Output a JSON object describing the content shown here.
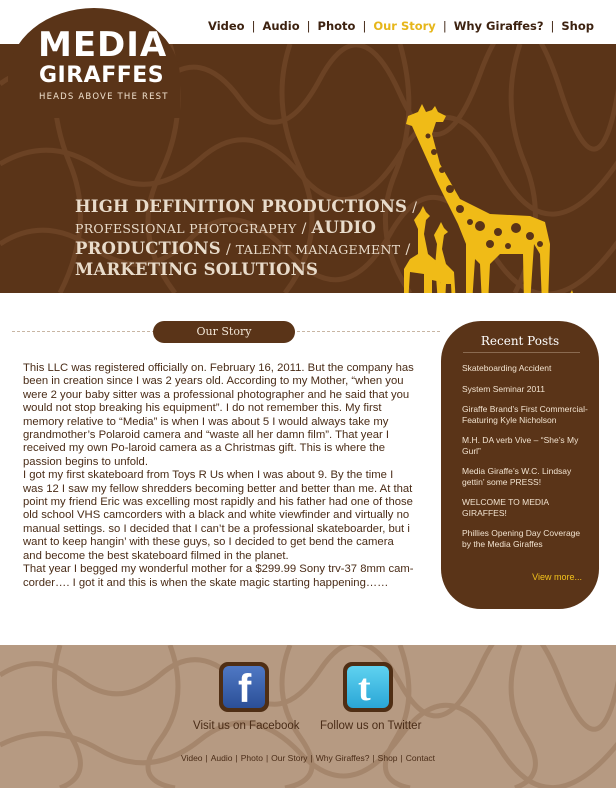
{
  "logo": {
    "line1": "MEDIA",
    "line2": "GIRAFFES",
    "tagline": "HEADS ABOVE THE REST"
  },
  "nav": {
    "items": [
      {
        "label": "Video",
        "active": false
      },
      {
        "label": "Audio",
        "active": false
      },
      {
        "label": "Photo",
        "active": false
      },
      {
        "label": "Our Story",
        "active": true
      },
      {
        "label": "Why Giraffes?",
        "active": false
      },
      {
        "label": "Shop",
        "active": false
      }
    ],
    "separator": "|"
  },
  "hero": {
    "service_1": "HIGH DEFINITION PRODUCTIONS",
    "service_2": "PROFESSIONAL PHOTOGRAPHY",
    "service_3": "AUDIO PRODUCTIONS",
    "service_4": "TALENT MANAGEMENT",
    "service_5": "MARKETING SOLUTIONS",
    "slash": "/"
  },
  "section": {
    "title": "Our Story"
  },
  "story": {
    "paragraph_1": "This LLC was registered officially on. February 16, 2011. But the company has been in creation since I was 2 years old. According to my Mother, “when you were 2 your baby sitter was a professional photographer and he said that you would not stop breaking his equipment”. I do not remember this. My first memory relative to “Media” is when I was about 5 I would always take my grandmother’s Polaroid camera and “waste all her damn film”. That year I received my own Po-laroid camera as a Christmas gift. This is where the passion begins to unfold.",
    "paragraph_2": "I got my first skateboard from Toys R Us when I was about 9. By the time I was 12 I saw my fellow shredders becoming better and better than me. At that point my friend Eric was excelling most rapidly and his father had one of those old school VHS camcorders with a black and white viewfinder and virtually no manual settings. so I decided that I can’t be a professional skateboarder, but i want to keep hangin’ with these guys, so I decided to get bend the camera and become the best skateboard filmed in the planet.",
    "paragraph_3": "That year I begged my wonderful mother for a $299.99 Sony trv-37 8mm cam-corder…. I got it and this is when the skate magic starting happening……"
  },
  "recent_posts": {
    "title": "Recent Posts",
    "items": [
      "Skateboarding Accident",
      "System Seminar 2011",
      "Giraffe Brand’s First Commercial-Featuring Kyle Nicholson",
      "M.H. DA verb Vive – “She’s My Gurl”",
      "Media Giraffe’s W.C. Lindsay gettin’ some PRESS!",
      "WELCOME TO MEDIA GIRAFFES!",
      "Phillies Opening Day Coverage by the Media Giraffes"
    ],
    "view_more": "View more..."
  },
  "footer": {
    "facebook_label": "Visit us on Facebook",
    "twitter_label": "Follow us on Twitter",
    "facebook_glyph": "f",
    "twitter_glyph": "t",
    "links": [
      "Video",
      "Audio",
      "Photo",
      "Our Story",
      "Why Giraffes?",
      "Shop",
      "Contact"
    ],
    "separator": "|"
  },
  "colors": {
    "brown": "#5a3418",
    "accent_yellow": "#e6b61a",
    "footer_tan": "#b69a82"
  }
}
